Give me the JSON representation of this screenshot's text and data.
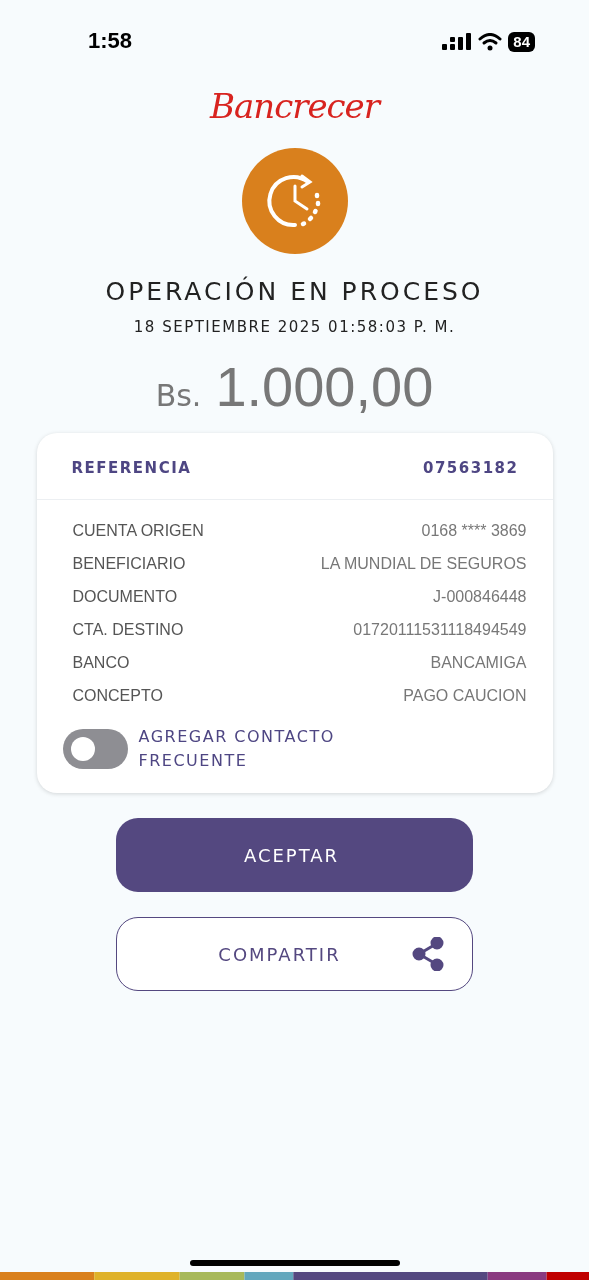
{
  "status_bar": {
    "time": "1:58",
    "battery": "84"
  },
  "logo": {
    "text": "Bancrecer"
  },
  "status": {
    "title": "OPERACIÓN EN PROCESO",
    "date": "18 SEPTIEMBRE 2025 01:58:03 P. M."
  },
  "amount": {
    "currency": "Bs.",
    "value": "1.000,00"
  },
  "receipt": {
    "reference": {
      "label": "REFERENCIA",
      "value": "07563182"
    },
    "rows": [
      {
        "label": "CUENTA ORIGEN",
        "value": "0168 **** 3869"
      },
      {
        "label": "BENEFICIARIO",
        "value": "LA MUNDIAL DE SEGUROS"
      },
      {
        "label": "DOCUMENTO",
        "value": "J-000846448"
      },
      {
        "label": "CTA. DESTINO",
        "value": "01720111531118494549"
      },
      {
        "label": "BANCO",
        "value": "BANCAMIGA"
      },
      {
        "label": "CONCEPTO",
        "value": "PAGO CAUCION"
      }
    ],
    "frequent_contact": {
      "label": "AGREGAR CONTACTO FRECUENTE",
      "on": false
    }
  },
  "buttons": [
    {
      "kind": "primary",
      "label": "ACEPTAR"
    },
    {
      "kind": "share",
      "label": "COMPARTIR"
    }
  ]
}
